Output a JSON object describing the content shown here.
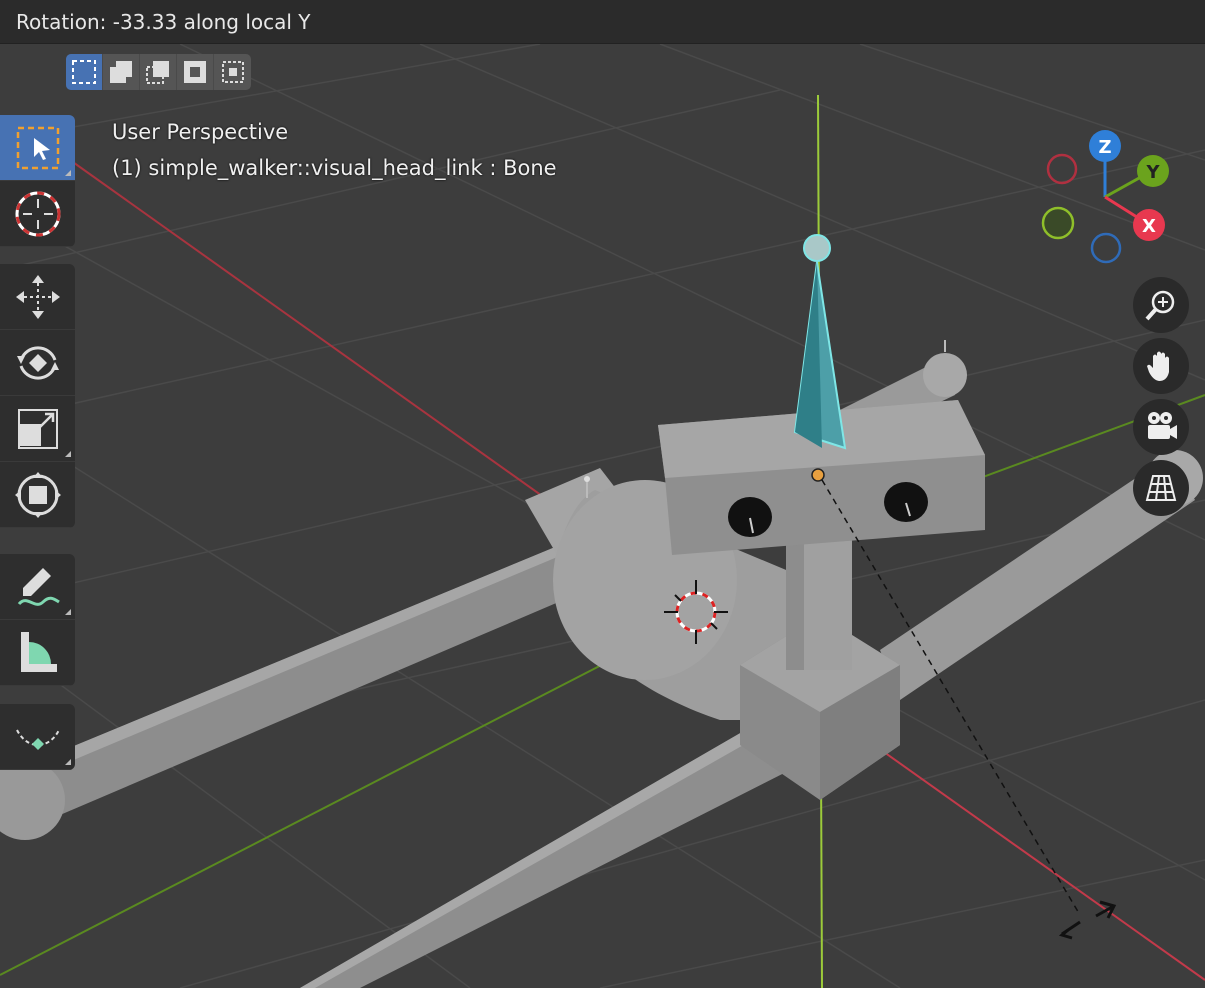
{
  "header": {
    "status": "Rotation: -33.33 along local Y"
  },
  "viewport": {
    "view_name": "User Perspective",
    "active_object": "(1) simple_walker::visual_head_link : Bone"
  },
  "gizmo": {
    "z": "Z",
    "y": "Y",
    "x": "X"
  },
  "icons": {
    "modes": [
      "select-new-icon",
      "select-extend-icon",
      "select-subtract-icon",
      "select-invert-icon",
      "select-intersect-icon"
    ],
    "tools": [
      "select-box-icon",
      "cursor-icon",
      "move-icon",
      "rotate-icon",
      "scale-icon",
      "transform-icon",
      "annotate-icon",
      "measure-icon",
      "bone-roll-icon"
    ],
    "nav": [
      "zoom-icon",
      "pan-hand-icon",
      "camera-icon",
      "grid-view-icon"
    ]
  },
  "colors": {
    "active": "#4772b3",
    "x_axis": "#e8384f",
    "y_axis": "#6ba31d",
    "z_axis": "#2f7fd8",
    "bone": "#7fe6e6"
  }
}
